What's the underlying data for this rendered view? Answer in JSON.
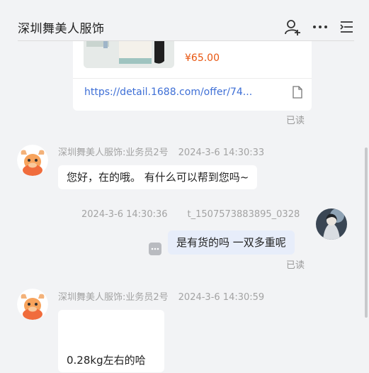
{
  "header": {
    "title": "深圳舞美人服饰",
    "icons": [
      "add-contact-icon",
      "more-icon",
      "menu-list-icon"
    ]
  },
  "product_card": {
    "price": "¥65.00",
    "link": "https://detail.1688.com/offer/74...",
    "read_status": "已读"
  },
  "messages": [
    {
      "sender": "深圳舞美人服饰:业务员2号",
      "time": "2024-3-6 14:30:33",
      "text": "您好，在的哦。 有什么可以帮到您吗~"
    },
    {
      "sender": "t_1507573883895_0328",
      "time": "2024-3-6 14:30:36",
      "text": "是有货的吗 一双多重呢",
      "read_status": "已读"
    },
    {
      "sender": "深圳舞美人服饰:业务员2号",
      "time": "2024-3-6 14:30:59",
      "text": "0.28kg左右的哈"
    }
  ],
  "colors": {
    "price": "#e8550f",
    "link": "#3e6fd6",
    "own_bubble": "#e7edfa",
    "background": "#f2f3f5"
  }
}
